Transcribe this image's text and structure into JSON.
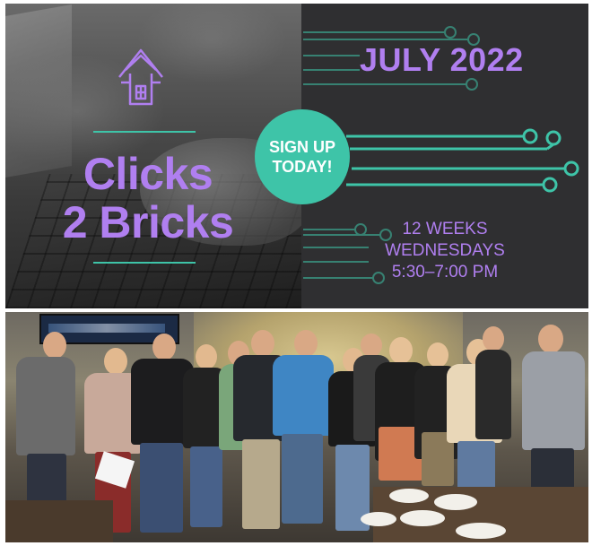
{
  "banner": {
    "title_line1": "Clicks",
    "title_line2": "2 Bricks",
    "month": "JULY 2022",
    "signup_line1": "SIGN UP",
    "signup_line2": "TODAY!",
    "duration": "12 WEEKS",
    "day": "WEDNESDAYS",
    "time": "5:30–7:00 PM"
  },
  "icons": [
    "house-icon"
  ],
  "colors": {
    "accent_purple": "#b07ff0",
    "accent_teal": "#3ec4a8",
    "panel_dark": "#2f2f31"
  }
}
